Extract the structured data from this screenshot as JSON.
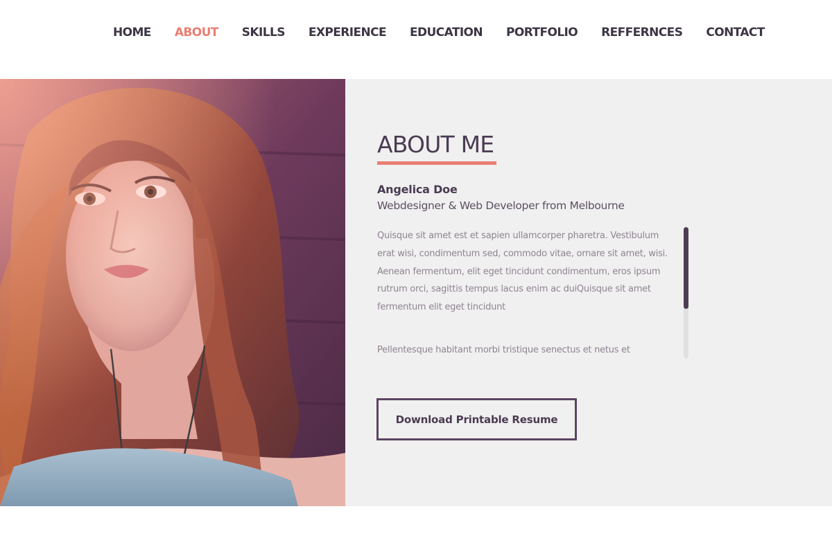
{
  "nav": {
    "items": [
      {
        "label": "HOME"
      },
      {
        "label": "ABOUT"
      },
      {
        "label": "SKILLS"
      },
      {
        "label": "EXPERIENCE"
      },
      {
        "label": "EDUCATION"
      },
      {
        "label": "PORTFOLIO"
      },
      {
        "label": "REFFERNCES"
      },
      {
        "label": "CONTACT"
      }
    ],
    "active": "ABOUT"
  },
  "about": {
    "title": "ABOUT ME",
    "name": "Angelica Doe",
    "role": "Webdesigner & Web Developer from Melbourne",
    "paragraphs": [
      "Quisque sit amet est et sapien ullamcorper pharetra. Vestibulum erat wisi, condimentum sed, commodo vitae, ornare sit amet, wisi. Aenean fermentum, elit eget tincidunt condimentum, eros ipsum rutrum orci, sagittis tempus lacus enim ac duiQuisque sit amet fermentum elit eget tincidunt",
      "Pellentesque habitant morbi tristique senectus et netus et"
    ],
    "button_label": "Download Printable Resume"
  },
  "colors": {
    "accent": "#ea7e72",
    "dark": "#4a3b52",
    "panel_bg": "#f1f0f0"
  }
}
